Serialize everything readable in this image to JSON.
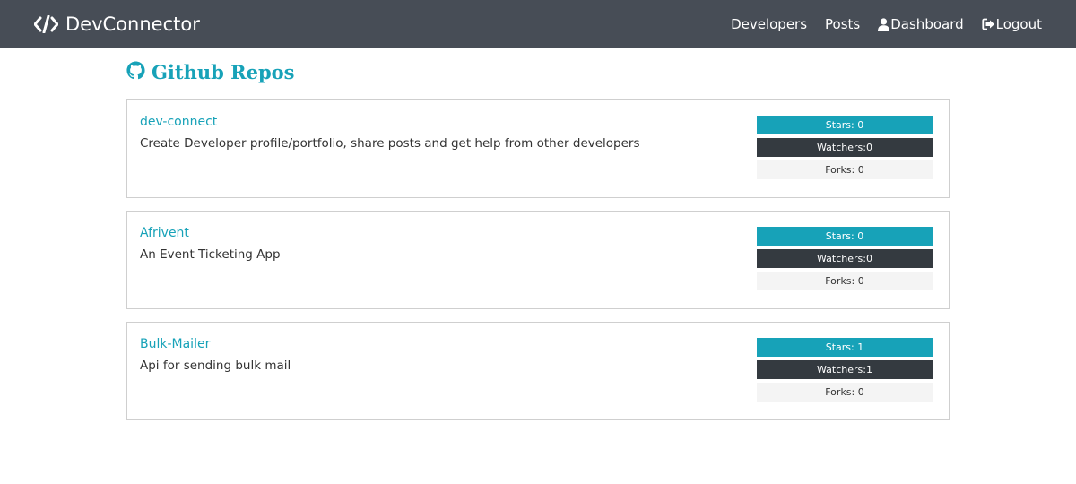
{
  "nav": {
    "brand": "DevConnector",
    "links": [
      {
        "label": "Developers",
        "icon": ""
      },
      {
        "label": "Posts",
        "icon": ""
      },
      {
        "label": "Dashboard",
        "icon": "user-icon"
      },
      {
        "label": "Logout",
        "icon": "sign-out-icon"
      }
    ]
  },
  "heading": {
    "title": "Github Repos",
    "icon": "github-icon"
  },
  "repos": [
    {
      "name": "dev-connect",
      "description": "Create Developer profile/portfolio, share posts and get help from other developers",
      "stars": "Stars: 0",
      "watchers": "Watchers:0",
      "forks": "Forks: 0"
    },
    {
      "name": "Afrivent",
      "description": "An Event Ticketing App",
      "stars": "Stars: 0",
      "watchers": "Watchers:0",
      "forks": "Forks: 0"
    },
    {
      "name": "Bulk-Mailer",
      "description": "Api for sending bulk mail",
      "stars": "Stars: 1",
      "watchers": "Watchers:1",
      "forks": "Forks: 0"
    }
  ],
  "colors": {
    "accent": "#17a2b8",
    "navbar": "#474d56",
    "dark": "#343a40",
    "light": "#f4f4f4"
  }
}
